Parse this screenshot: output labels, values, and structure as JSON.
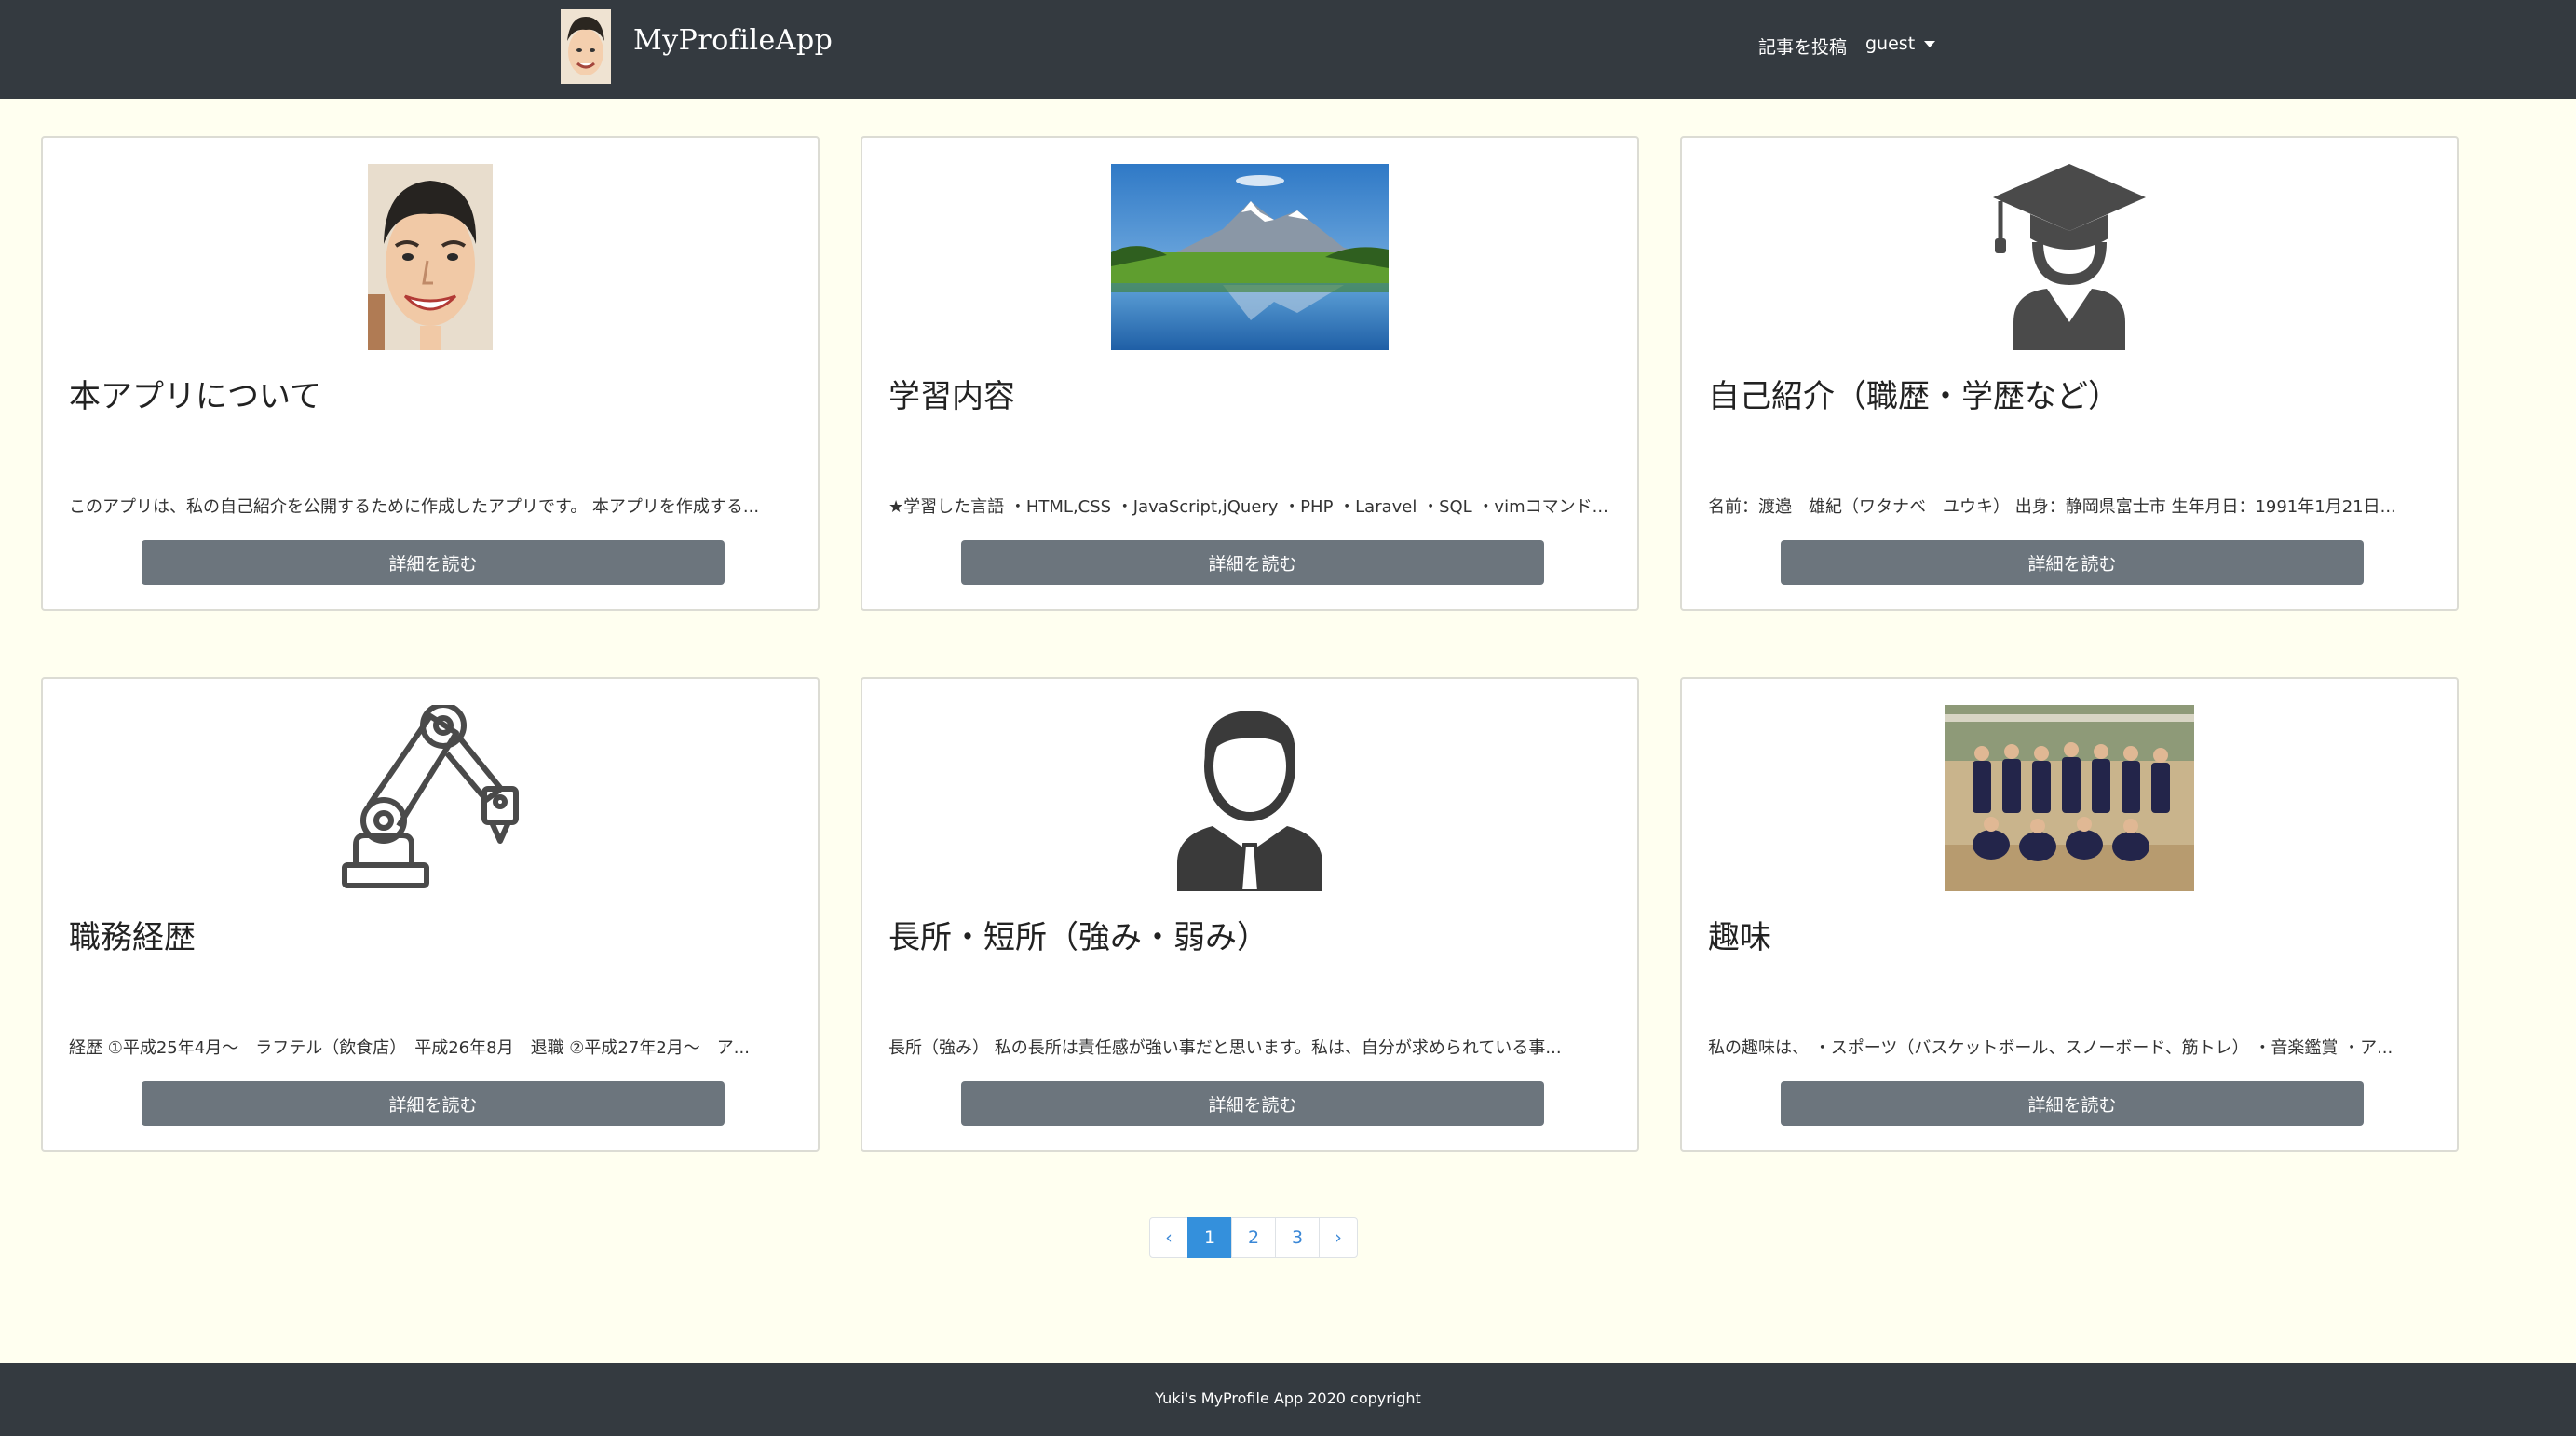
{
  "navbar": {
    "brand": "MyProfileApp",
    "post_link": "記事を投稿",
    "user_menu": "guest"
  },
  "cards": [
    {
      "title": "本アプリについて",
      "excerpt": "このアプリは、私の自己紹介を公開するために作成したアプリです。 本アプリを作成する...",
      "button": "詳細を読む",
      "image": "portrait-illustration"
    },
    {
      "title": "学習内容",
      "excerpt": "★学習した言語 ・HTML,CSS ・JavaScript,jQuery ・PHP ・Laravel ・SQL ・vimコマンド...",
      "button": "詳細を読む",
      "image": "mountain-lake-photo"
    },
    {
      "title": "自己紹介（職歴・学歴など）",
      "excerpt": "名前：渡邉　雄紀（ワタナベ　ユウキ） 出身：静岡県富士市 生年月日：1991年1月21日...",
      "button": "詳細を読む",
      "image": "graduate-icon"
    },
    {
      "title": "職務経歴",
      "excerpt": "経歴 ①平成25年4月〜　ラフテル（飲食店）　平成26年8月　退職 ②平成27年2月〜　ア...",
      "button": "詳細を読む",
      "image": "robot-arm-icon"
    },
    {
      "title": "長所・短所（強み・弱み）",
      "excerpt": "長所（強み） 私の長所は責任感が強い事だと思います。私は、自分が求められている事...",
      "button": "詳細を読む",
      "image": "businessman-icon"
    },
    {
      "title": "趣味",
      "excerpt": "私の趣味は、 ・スポーツ（バスケットボール、スノーボード、筋トレ） ・音楽鑑賞 ・ア...",
      "button": "詳細を読む",
      "image": "basketball-team-photo"
    }
  ],
  "pagination": {
    "prev": "‹",
    "pages": [
      "1",
      "2",
      "3"
    ],
    "active": "1",
    "next": "›"
  },
  "footer": {
    "text": "Yuki's MyProfile App 2020 copyright"
  }
}
